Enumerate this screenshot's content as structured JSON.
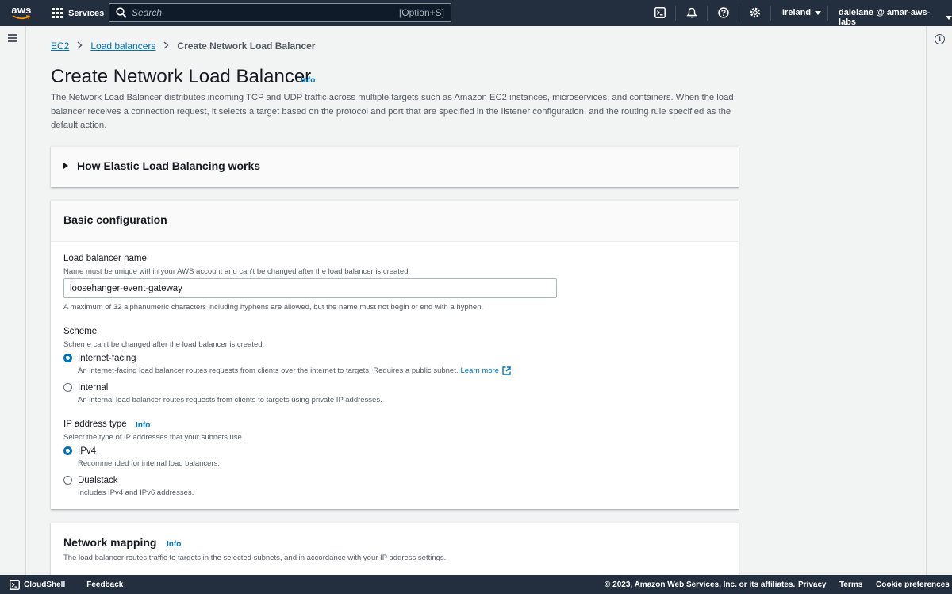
{
  "topnav": {
    "logo_text": "aws",
    "services_label": "Services",
    "search_placeholder": "Search",
    "search_shortcut": "[Option+S]",
    "region": "Ireland",
    "account": "dalelane @ amar-aws-labs",
    "icons": [
      "cloudshell-icon",
      "bell-icon",
      "help-icon",
      "gear-icon"
    ]
  },
  "breadcrumb": {
    "items": [
      "EC2",
      "Load balancers"
    ],
    "current": "Create Network Load Balancer"
  },
  "page": {
    "title": "Create Network Load Balancer",
    "title_info": "Info",
    "description": "The Network Load Balancer distributes incoming TCP and UDP traffic across multiple targets such as Amazon EC2 instances, microservices, and containers. When the load balancer receives a connection request, it selects a target based on the protocol and port that are specified in the listener configuration, and the routing rule specified as the default action."
  },
  "how_panel": {
    "title": "How Elastic Load Balancing works"
  },
  "basic_config": {
    "title": "Basic configuration",
    "name_label": "Load balancer name",
    "name_desc": "Name must be unique within your AWS account and can't be changed after the load balancer is created.",
    "name_value": "loosehanger-event-gateway",
    "name_constraint": "A maximum of 32 alphanumeric characters including hyphens are allowed, but the name must not begin or end with a hyphen.",
    "scheme_label": "Scheme",
    "scheme_desc": "Scheme can't be changed after the load balancer is created.",
    "scheme_options": [
      {
        "title": "Internet-facing",
        "desc": "An internet-facing load balancer routes requests from clients over the internet to targets. Requires a public subnet.",
        "link": "Learn more",
        "checked": true
      },
      {
        "title": "Internal",
        "desc": "An internal load balancer routes requests from clients to targets using private IP addresses.",
        "checked": false
      }
    ],
    "ip_label": "IP address type",
    "ip_info": "Info",
    "ip_desc": "Select the type of IP addresses that your subnets use.",
    "ip_options": [
      {
        "title": "IPv4",
        "desc": "Recommended for internal load balancers.",
        "checked": true
      },
      {
        "title": "Dualstack",
        "desc": "Includes IPv4 and IPv6 addresses.",
        "checked": false
      }
    ]
  },
  "network_mapping": {
    "title": "Network mapping",
    "info": "Info",
    "description": "The load balancer routes traffic to targets in the selected subnets, and in accordance with your IP address settings."
  },
  "footer": {
    "cloudshell": "CloudShell",
    "feedback": "Feedback",
    "copyright": "© 2023, Amazon Web Services, Inc. or its affiliates.",
    "privacy": "Privacy",
    "terms": "Terms",
    "cookies": "Cookie preferences"
  },
  "colors": {
    "nav_bg": "#232f3e",
    "link": "#0073bb",
    "page_bg": "#f2f3f3"
  }
}
